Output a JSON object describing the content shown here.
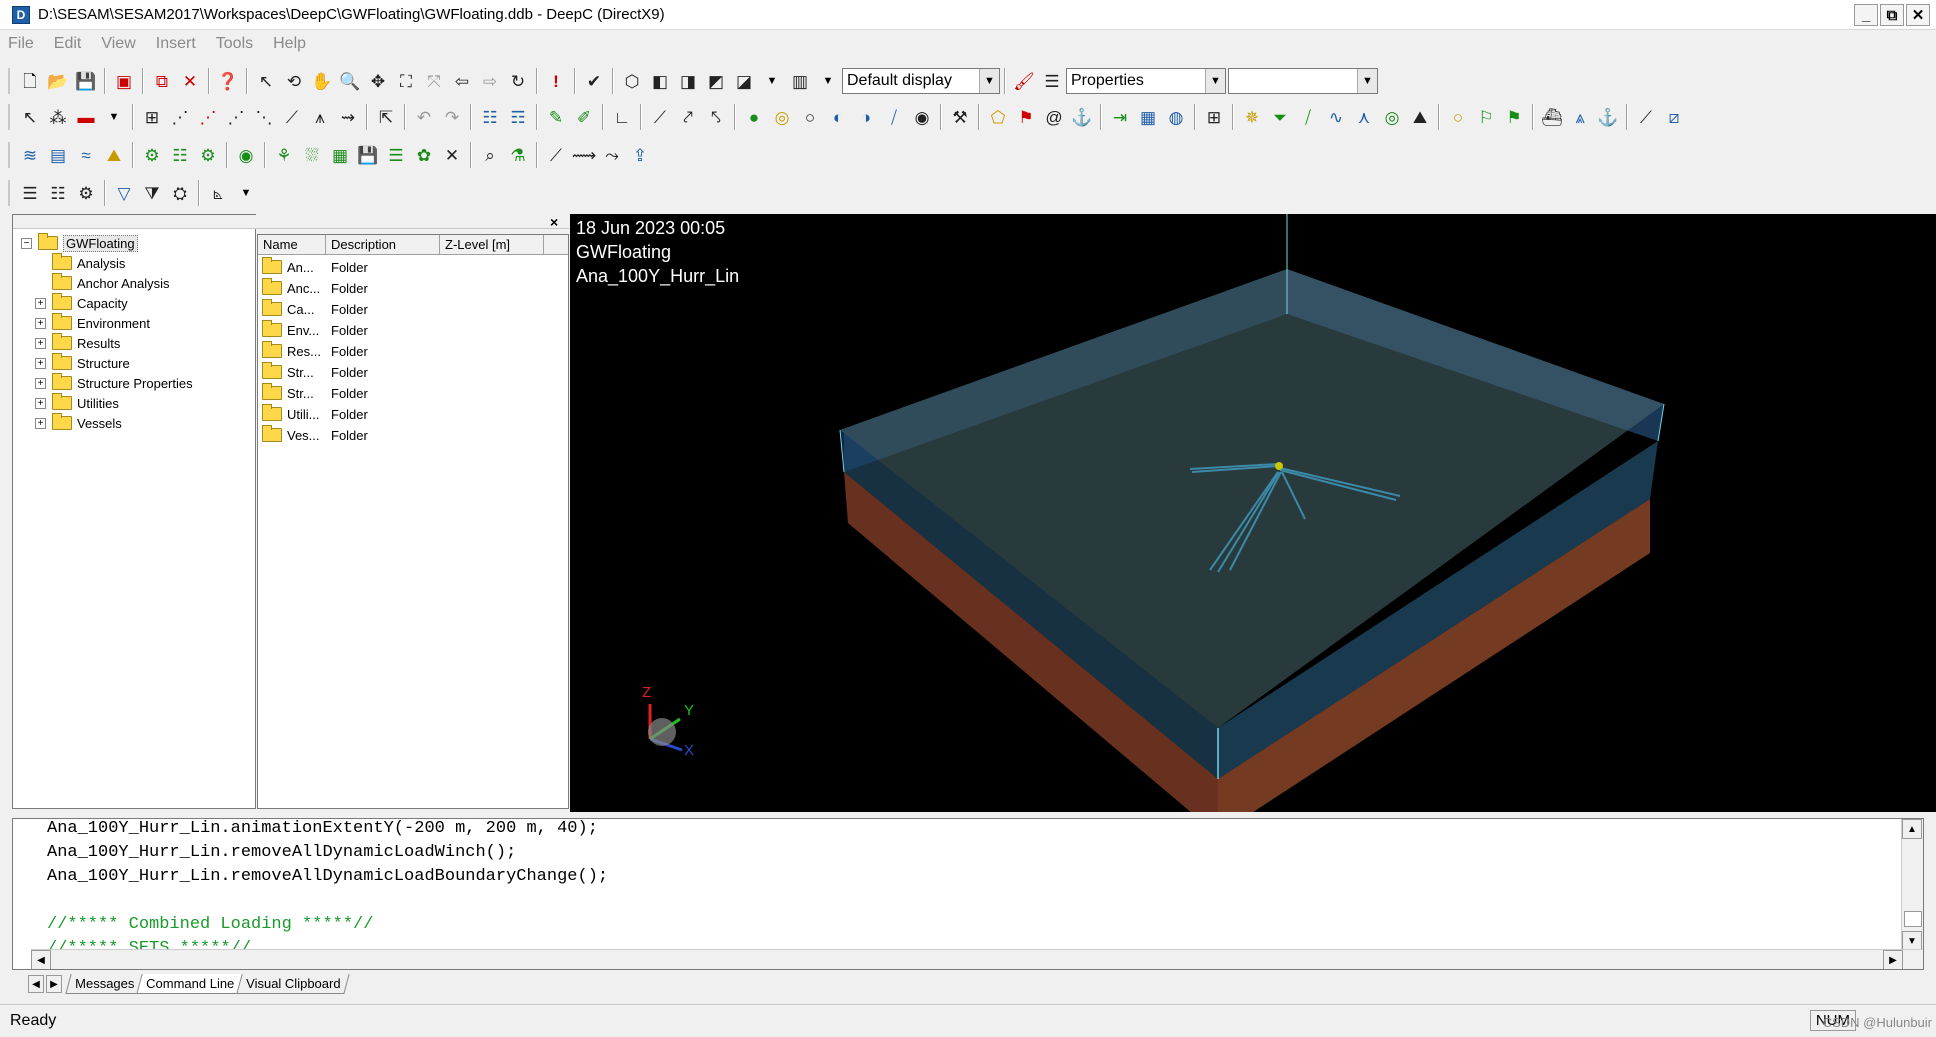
{
  "window": {
    "title": "D:\\SESAM\\SESAM2017\\Workspaces\\DeepC\\GWFloating\\GWFloating.ddb - DeepC (DirectX9)",
    "app_icon": "D",
    "controls": [
      "_",
      "⧉",
      "✕"
    ]
  },
  "menu": [
    "File",
    "Edit",
    "View",
    "Insert",
    "Tools",
    "Help"
  ],
  "toolbar": {
    "display_combo": "Default display",
    "properties_combo": "Properties",
    "third_combo": ""
  },
  "tree": {
    "root": "GWFloating",
    "items": [
      {
        "label": "Analysis",
        "expandable": false
      },
      {
        "label": "Anchor Analysis",
        "expandable": false
      },
      {
        "label": "Capacity",
        "expandable": true
      },
      {
        "label": "Environment",
        "expandable": true
      },
      {
        "label": "Results",
        "expandable": true
      },
      {
        "label": "Structure",
        "expandable": true
      },
      {
        "label": "Structure Properties",
        "expandable": true
      },
      {
        "label": "Utilities",
        "expandable": true
      },
      {
        "label": "Vessels",
        "expandable": true
      }
    ]
  },
  "list": {
    "columns": [
      "Name",
      "Description",
      "Z-Level [m]"
    ],
    "rows": [
      {
        "name": "An...",
        "description": "Folder"
      },
      {
        "name": "Anc...",
        "description": "Folder"
      },
      {
        "name": "Ca...",
        "description": "Folder"
      },
      {
        "name": "Env...",
        "description": "Folder"
      },
      {
        "name": "Res...",
        "description": "Folder"
      },
      {
        "name": "Str...",
        "description": "Folder"
      },
      {
        "name": "Str...",
        "description": "Folder"
      },
      {
        "name": "Utili...",
        "description": "Folder"
      },
      {
        "name": "Ves...",
        "description": "Folder"
      }
    ]
  },
  "viewport": {
    "date": "18 Jun 2023 00:05",
    "workspace": "GWFloating",
    "analysis": "Ana_100Y_Hurr_Lin",
    "axis_labels": {
      "x": "X",
      "y": "Y",
      "z": "Z"
    }
  },
  "console": {
    "lines": [
      {
        "text": "Ana_100Y_Hurr_Lin.animationExtentY(-200 m, 200 m, 40);",
        "color": "#000000"
      },
      {
        "text": "Ana_100Y_Hurr_Lin.removeAllDynamicLoadWinch();",
        "color": "#000000"
      },
      {
        "text": "Ana_100Y_Hurr_Lin.removeAllDynamicLoadBoundaryChange();",
        "color": "#000000"
      },
      {
        "text": "",
        "color": "#000000"
      },
      {
        "text": "//***** Combined Loading *****//",
        "color": "#1a9a2a"
      },
      {
        "text": "//***** SETS *****//",
        "color": "#1a9a2a"
      }
    ]
  },
  "tabs": [
    "Messages",
    "Command Line",
    "Visual Clipboard"
  ],
  "status": {
    "ready": "Ready",
    "num": "NUM",
    "watermark": "CSDN @Hulunbuir"
  },
  "panel_close": "×",
  "console_close": "×"
}
